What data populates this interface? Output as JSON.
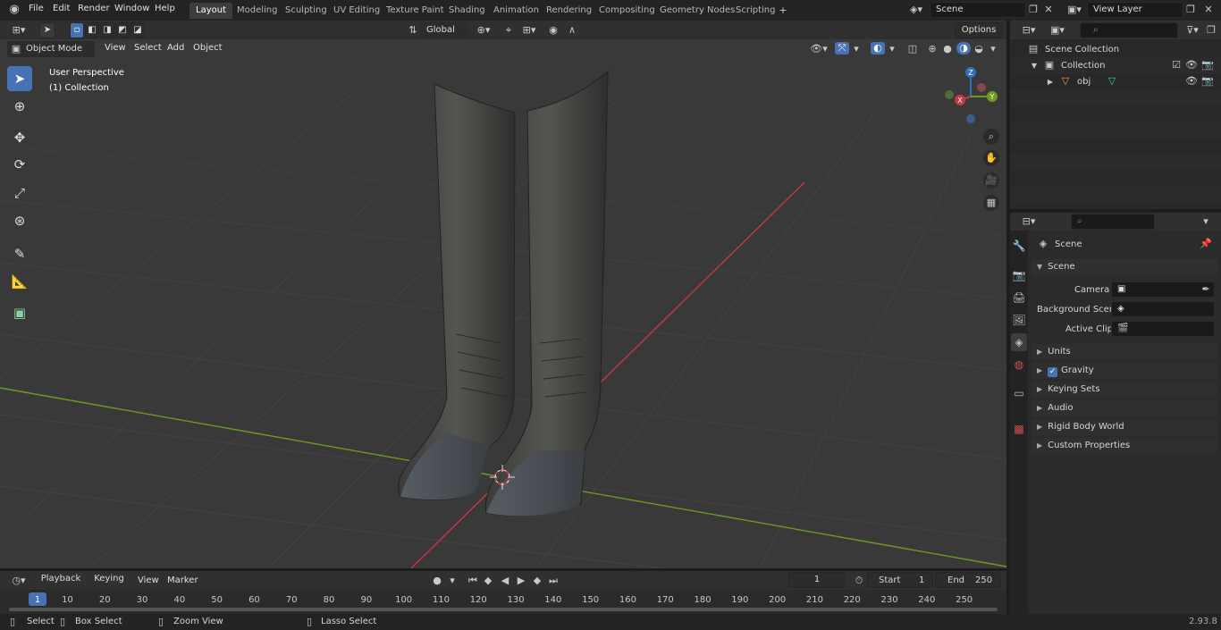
{
  "menus": [
    "File",
    "Edit",
    "Render",
    "Window",
    "Help"
  ],
  "workspaces": [
    "Layout",
    "Modeling",
    "Sculpting",
    "UV Editing",
    "Texture Paint",
    "Shading",
    "Animation",
    "Rendering",
    "Compositing",
    "Geometry Nodes",
    "Scripting"
  ],
  "active_workspace": "Layout",
  "scene_name": "Scene",
  "view_layer": "View Layer",
  "viewport": {
    "mode": "Object Mode",
    "menus": [
      "View",
      "Select",
      "Add",
      "Object"
    ],
    "transform_orientation": "Global",
    "options_label": "Options",
    "perspective_label": "User Perspective",
    "collection_label": "(1) Collection",
    "gizmo_axes": {
      "z": "Z",
      "y": "Y",
      "x": "X"
    }
  },
  "outliner": {
    "scene_collection": "Scene Collection",
    "collection": "Collection",
    "object": "obj"
  },
  "properties": {
    "header": "Scene",
    "section": "Scene",
    "camera_label": "Camera",
    "background_scene_label": "Background Scene",
    "active_clip_label": "Active Clip",
    "panels": [
      "Units",
      "Gravity",
      "Keying Sets",
      "Audio",
      "Rigid Body World",
      "Custom Properties"
    ]
  },
  "timeline": {
    "menus": [
      "Playback",
      "Keying",
      "View",
      "Marker"
    ],
    "current_frame": "1",
    "start_label": "Start",
    "start_value": "1",
    "end_label": "End",
    "end_value": "250",
    "ticks": [
      "1",
      "10",
      "20",
      "30",
      "40",
      "50",
      "60",
      "70",
      "80",
      "90",
      "100",
      "110",
      "120",
      "130",
      "140",
      "150",
      "160",
      "170",
      "180",
      "190",
      "200",
      "210",
      "220",
      "230",
      "240",
      "250"
    ]
  },
  "statusbar": {
    "items": [
      "Select",
      "Box Select",
      "Zoom View",
      "Lasso Select"
    ],
    "version": "2.93.8"
  },
  "colors": {
    "accent": "#4772b3",
    "x_axis": "#c33a44",
    "y_axis": "#6f9a21",
    "z_axis": "#2e6fbf"
  }
}
